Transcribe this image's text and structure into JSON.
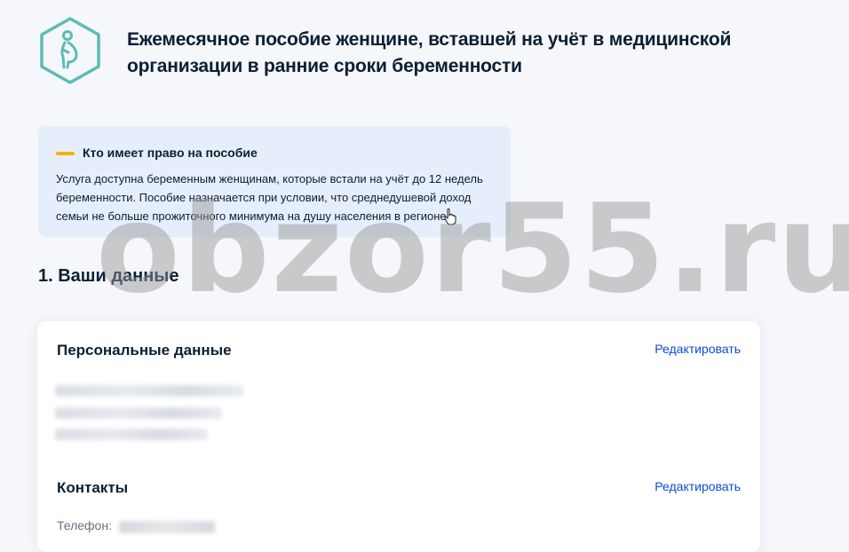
{
  "page": {
    "title": "Ежемесячное пособие женщине, вставшей на учёт в медицинской организации в ранние сроки беременности",
    "icon": "pregnant-woman-icon",
    "accent_color": "#5cbcb3"
  },
  "info": {
    "heading": "Кто имеет право на пособие",
    "text": "Услуга доступна беременным женщинам, которые встали на учёт до 12 недель беременности. Пособие назначается при условии, что среднедушевой доход семьи не больше прожиточного минимума на душу населения в регионе",
    "accent_color": "#f5b301"
  },
  "section": {
    "title": "1. Ваши данные"
  },
  "personal": {
    "heading": "Персональные данные",
    "edit_label": "Редактировать"
  },
  "contacts": {
    "heading": "Контакты",
    "edit_label": "Редактировать",
    "phone_label": "Телефон:"
  },
  "watermark": {
    "text": "obzor55.ru"
  },
  "colors": {
    "link": "#0d4cd3",
    "background": "#f5f7fb"
  }
}
